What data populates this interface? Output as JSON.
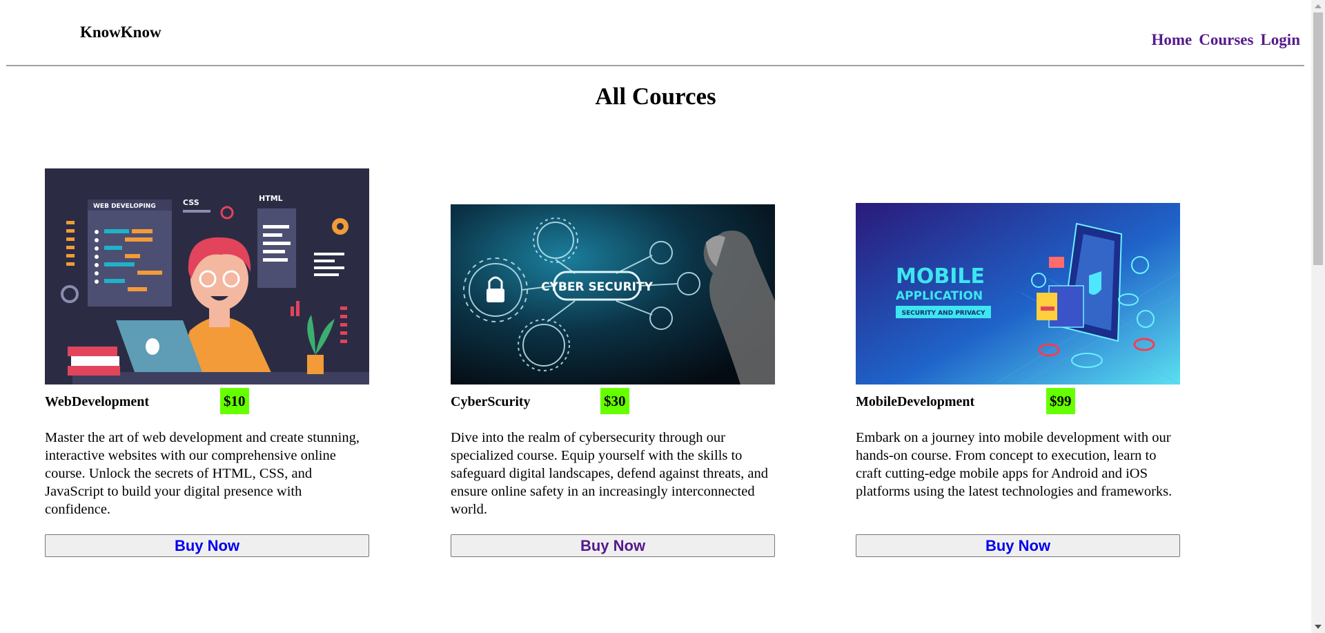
{
  "header": {
    "brand": "KnowKnow",
    "nav": [
      {
        "label": "Home"
      },
      {
        "label": "Courses"
      },
      {
        "label": "Login"
      }
    ]
  },
  "page": {
    "title": "All Cources"
  },
  "courses": [
    {
      "name": "WebDevelopment",
      "price": "$10",
      "description": "Master the art of web development and create stunning, interactive websites with our comprehensive online course. Unlock the secrets of HTML, CSS, and JavaScript to build your digital presence with confidence.",
      "button": "Buy Now",
      "image_icon": "web-developer-illustration",
      "image_text": {
        "panel": "WEB DEVELOPING",
        "css": "CSS",
        "html": "HTML"
      }
    },
    {
      "name": "CyberScurity",
      "price": "$30",
      "description": "Dive into the realm of cybersecurity through our specialized course. Equip yourself with the skills to safeguard digital landscapes, defend against threats, and ensure online safety in an increasingly interconnected world.",
      "button": "Buy Now",
      "image_icon": "cyber-security-illustration",
      "image_text": {
        "label": "CYBER SECURITY"
      }
    },
    {
      "name": "MobileDevelopment",
      "price": "$99",
      "description": "Embark on a journey into mobile development with our hands-on course. From concept to execution, learn to craft cutting-edge mobile apps for Android and iOS platforms using the latest technologies and frameworks.",
      "button": "Buy Now",
      "image_icon": "mobile-application-illustration",
      "image_text": {
        "line1": "MOBILE",
        "line2": "APPLICATION",
        "line3": "SECURITY AND PRIVACY"
      }
    }
  ],
  "colors": {
    "nav_link": "#551a8b",
    "button_text": "#0000ee",
    "price_badge": "#66ff00"
  }
}
